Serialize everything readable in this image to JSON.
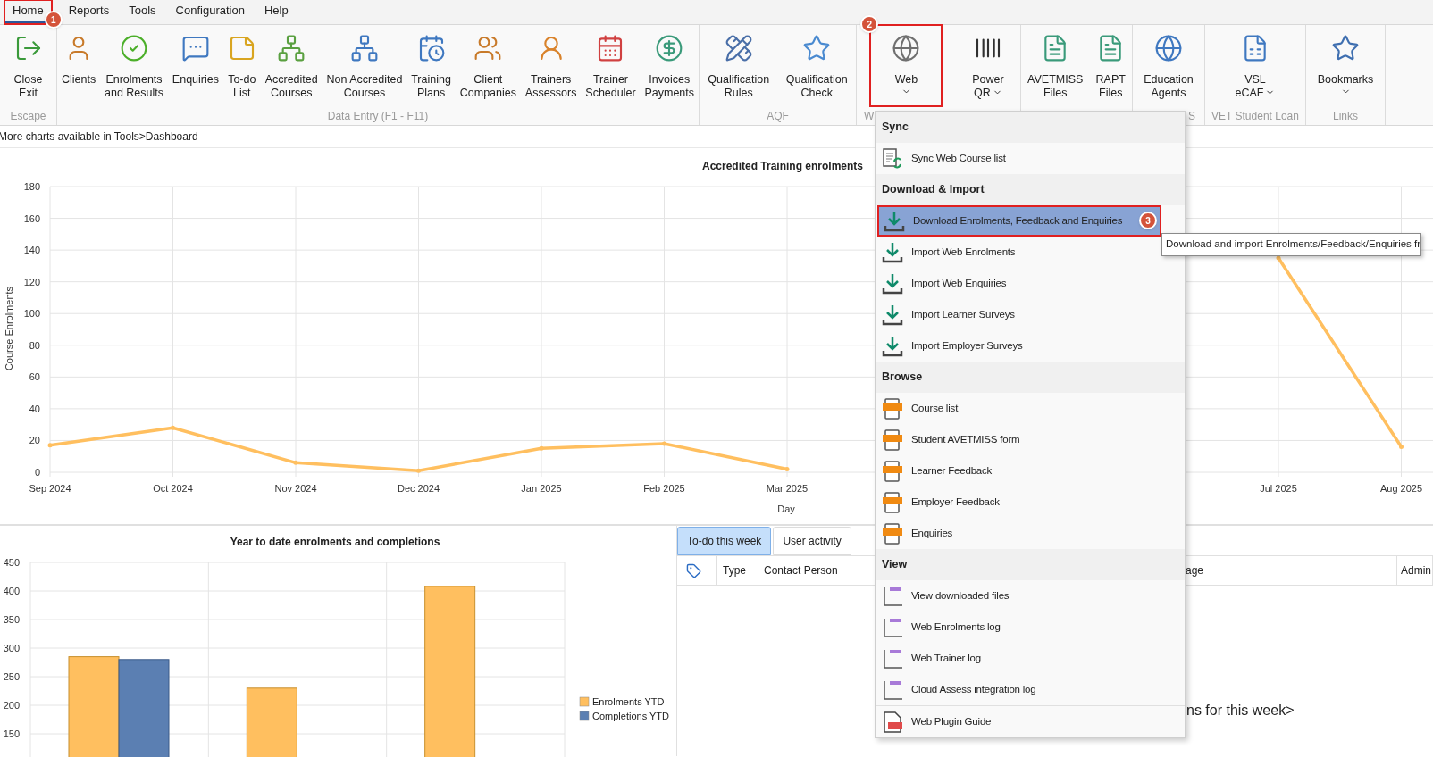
{
  "menu_bar": {
    "tabs": [
      {
        "label": "Home",
        "selected": true,
        "highlighted": true,
        "callout": "1"
      },
      {
        "label": "Reports",
        "selected": false,
        "highlighted": false
      },
      {
        "label": "Tools",
        "selected": false,
        "highlighted": false
      },
      {
        "label": "Configuration",
        "selected": false,
        "highlighted": false
      },
      {
        "label": "Help",
        "selected": false,
        "highlighted": false
      }
    ]
  },
  "ribbon": {
    "groups": [
      {
        "label": "Escape",
        "buttons": [
          {
            "lines": [
              "Close",
              "Exit"
            ],
            "dropdown": false,
            "highlighted": false
          }
        ]
      },
      {
        "label": "Data Entry (F1 - F11)",
        "buttons": [
          {
            "lines": [
              "Clients"
            ],
            "dropdown": false,
            "highlighted": false
          },
          {
            "lines": [
              "Enrolments",
              "and Results"
            ],
            "dropdown": false,
            "highlighted": false
          },
          {
            "lines": [
              "Enquiries"
            ],
            "dropdown": false,
            "highlighted": false
          },
          {
            "lines": [
              "To-do",
              "List"
            ],
            "dropdown": false,
            "highlighted": false
          },
          {
            "lines": [
              "Accredited",
              "Courses"
            ],
            "dropdown": false,
            "highlighted": false
          },
          {
            "lines": [
              "Non Accredited",
              "Courses"
            ],
            "dropdown": false,
            "highlighted": false
          },
          {
            "lines": [
              "Training",
              "Plans"
            ],
            "dropdown": false,
            "highlighted": false
          },
          {
            "lines": [
              "Client",
              "Companies"
            ],
            "dropdown": false,
            "highlighted": false
          },
          {
            "lines": [
              "Trainers",
              "Assessors"
            ],
            "dropdown": false,
            "highlighted": false
          },
          {
            "lines": [
              "Trainer",
              "Scheduler"
            ],
            "dropdown": false,
            "highlighted": false
          },
          {
            "lines": [
              "Invoices",
              "Payments"
            ],
            "dropdown": false,
            "highlighted": false
          }
        ]
      },
      {
        "label": "AQF",
        "buttons": [
          {
            "lines": [
              "Qualification",
              "Rules"
            ],
            "dropdown": false,
            "highlighted": false
          },
          {
            "lines": [
              "Qualification",
              "Check"
            ],
            "dropdown": false,
            "highlighted": false
          }
        ]
      },
      {
        "label": "W",
        "buttons": [
          {
            "lines": [
              "Web"
            ],
            "dropdown": true,
            "highlighted": true,
            "callout": "2"
          },
          {
            "lines": [
              "Power",
              "QR"
            ],
            "dropdown": true,
            "highlighted": false
          }
        ]
      },
      {
        "buttons": [
          {
            "lines": [
              "AVETMISS",
              "Files"
            ],
            "dropdown": false,
            "highlighted": false
          },
          {
            "lines": [
              "RAPT",
              "Files"
            ],
            "dropdown": false,
            "highlighted": false
          }
        ]
      },
      {
        "label": "S",
        "buttons": [
          {
            "lines": [
              "Education",
              "Agents"
            ],
            "dropdown": false,
            "highlighted": false
          }
        ]
      },
      {
        "label": "VET Student Loan",
        "buttons": [
          {
            "lines": [
              "VSL",
              "eCAF"
            ],
            "dropdown": true,
            "highlighted": false
          }
        ]
      },
      {
        "label": "Links",
        "buttons": [
          {
            "lines": [
              "Bookmarks"
            ],
            "dropdown": true,
            "highlighted": false
          }
        ]
      }
    ]
  },
  "info_text": "More charts available in Tools>Dashboard",
  "line_chart": {
    "chart_data": {
      "type": "line",
      "title": "Accredited Training enrolments",
      "xlabel": "Day",
      "ylabel": "Course Enrolments",
      "categories": [
        "Sep 2024",
        "Oct 2024",
        "Nov 2024",
        "Dec 2024",
        "Jan 2025",
        "Feb 2025",
        "Mar 2025",
        null,
        null,
        null,
        "Jul 2025",
        "Aug 2025"
      ],
      "series": [
        {
          "color": "#ffbf5f",
          "values": [
            17,
            28,
            6,
            1,
            15,
            18,
            2,
            null,
            null,
            null,
            135,
            16
          ]
        }
      ],
      "ylim": [
        0,
        180
      ],
      "yticks": [
        0,
        20,
        40,
        60,
        80,
        100,
        120,
        140,
        160,
        180
      ],
      "grid": true
    }
  },
  "bar_chart": {
    "chart_data": {
      "type": "bar",
      "title": "Year to date enrolments and completions",
      "series": [
        {
          "name": "Enrolments YTD",
          "color": "#ffbf5f",
          "values": [
            285,
            230,
            408
          ]
        },
        {
          "name": "Completions YTD",
          "color": "#5b7fb2",
          "values": [
            280,
            null,
            null
          ]
        }
      ],
      "ylim": [
        150,
        450
      ],
      "yticks": [
        150,
        200,
        250,
        300,
        350,
        400,
        450
      ],
      "grid": true,
      "legend": true
    }
  },
  "activity_panel": {
    "tabs": [
      {
        "label": "To-do this week",
        "selected": true
      },
      {
        "label": "User activity",
        "selected": false
      }
    ],
    "columns": [
      {
        "kind": "icon"
      },
      {
        "kind": "text",
        "label": "Type"
      },
      {
        "kind": "text",
        "label": "Contact Person"
      },
      {
        "kind": "text",
        "label": "age"
      },
      {
        "kind": "text",
        "label": "Admin"
      }
    ],
    "message": "ns for this week>"
  },
  "web_menu": {
    "sections": [
      {
        "header": "Sync",
        "items": [
          {
            "label": "Sync Web Course list",
            "kind": "sync",
            "highlighted": false
          }
        ]
      },
      {
        "header": "Download & Import",
        "items": [
          {
            "label": "Download Enrolments, Feedback and Enquiries",
            "kind": "download",
            "highlighted": true,
            "callout": "3"
          },
          {
            "label": "Import Web Enrolments",
            "kind": "download",
            "highlighted": false
          },
          {
            "label": "Import Web Enquiries",
            "kind": "download",
            "highlighted": false
          },
          {
            "label": "Import Learner Surveys",
            "kind": "download",
            "highlighted": false
          },
          {
            "label": "Import Employer Surveys",
            "kind": "download",
            "highlighted": false
          }
        ]
      },
      {
        "header": "Browse",
        "items": [
          {
            "label": "Course list",
            "kind": "html",
            "highlighted": false
          },
          {
            "label": "Student AVETMISS form",
            "kind": "html",
            "highlighted": false
          },
          {
            "label": "Learner Feedback",
            "kind": "html",
            "highlighted": false
          },
          {
            "label": "Employer Feedback",
            "kind": "html",
            "highlighted": false
          },
          {
            "label": "Enquiries",
            "kind": "html",
            "highlighted": false
          }
        ]
      },
      {
        "header": "View",
        "items": [
          {
            "label": "View downloaded files",
            "kind": "log",
            "highlighted": false
          },
          {
            "label": "Web Enrolments log",
            "kind": "log",
            "highlighted": false
          },
          {
            "label": "Web Trainer log",
            "kind": "log",
            "highlighted": false
          },
          {
            "label": "Cloud Assess integration log",
            "kind": "log",
            "highlighted": false
          }
        ]
      },
      {
        "items": [
          {
            "label": "Web Plugin Guide",
            "kind": "pdf",
            "highlighted": false
          }
        ]
      }
    ]
  },
  "tooltip": {
    "text": "Download and import Enrolments/Feedback/Enquiries fr"
  }
}
